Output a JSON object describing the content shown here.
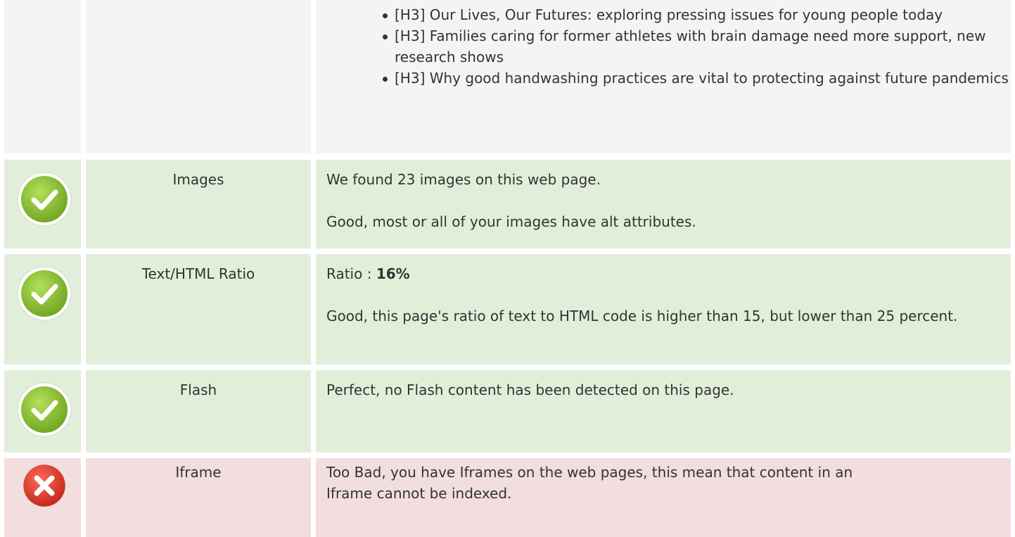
{
  "headings_list": {
    "items": [
      "[H3] Our Lives, Our Futures: exploring pressing issues for young people today",
      "[H3] Families caring for former athletes with brain damage need more support, new research shows",
      "[H3] Why good handwashing practices are vital to protecting against future pandemics"
    ]
  },
  "rows": {
    "images": {
      "status": "pass",
      "icon": "check-circle-icon",
      "label": "Images",
      "line1": "We found 23 images on this web page.",
      "line2": "Good, most or all of your images have alt attributes."
    },
    "text_html_ratio": {
      "status": "pass",
      "icon": "check-circle-icon",
      "label": "Text/HTML Ratio",
      "ratio_prefix": "Ratio : ",
      "ratio_value": "16%",
      "line2": "Good, this page's ratio of text to HTML code is higher than 15, but lower than 25 percent."
    },
    "flash": {
      "status": "pass",
      "icon": "check-circle-icon",
      "label": "Flash",
      "line1": "Perfect, no Flash content has been detected on this page."
    },
    "iframe": {
      "status": "fail",
      "icon": "error-x-circle-icon",
      "label": "Iframe",
      "line1": "Too Bad, you have Iframes on the web pages, this mean that content in an Iframe cannot be indexed."
    }
  },
  "colors": {
    "pass_bg": "#e1efda",
    "fail_bg": "#f2dede",
    "neutral_bg": "#f4f4f4",
    "check_green": "#8dc63f",
    "error_red": "#e74c3c"
  }
}
